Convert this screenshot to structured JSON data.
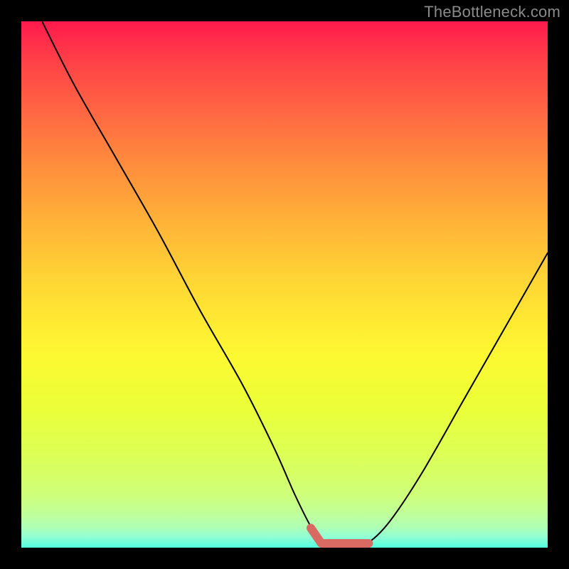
{
  "watermark": "TheBottleneck.com",
  "chart_data": {
    "type": "line",
    "title": "",
    "xlabel": "",
    "ylabel": "",
    "xlim": [
      0,
      100
    ],
    "ylim": [
      0,
      100
    ],
    "grid": false,
    "legend": false,
    "series": [
      {
        "name": "bottleneck-curve",
        "x": [
          4,
          10,
          18,
          26,
          34,
          42,
          48,
          52,
          55,
          57,
          60,
          63,
          66,
          70,
          76,
          84,
          92,
          100
        ],
        "values": [
          100,
          88,
          74,
          60,
          45,
          31,
          19,
          10,
          4,
          1,
          0,
          0,
          1,
          5,
          14,
          28,
          42,
          56
        ]
      }
    ],
    "annotations": [
      {
        "name": "optimal-zone",
        "x_range": [
          55,
          66
        ],
        "value": 0
      }
    ],
    "colors": {
      "curve": "#000000",
      "optimal_zone": "#d86a63",
      "gradient_top": "#ff1a4d",
      "gradient_bottom": "#50ffdc"
    }
  }
}
